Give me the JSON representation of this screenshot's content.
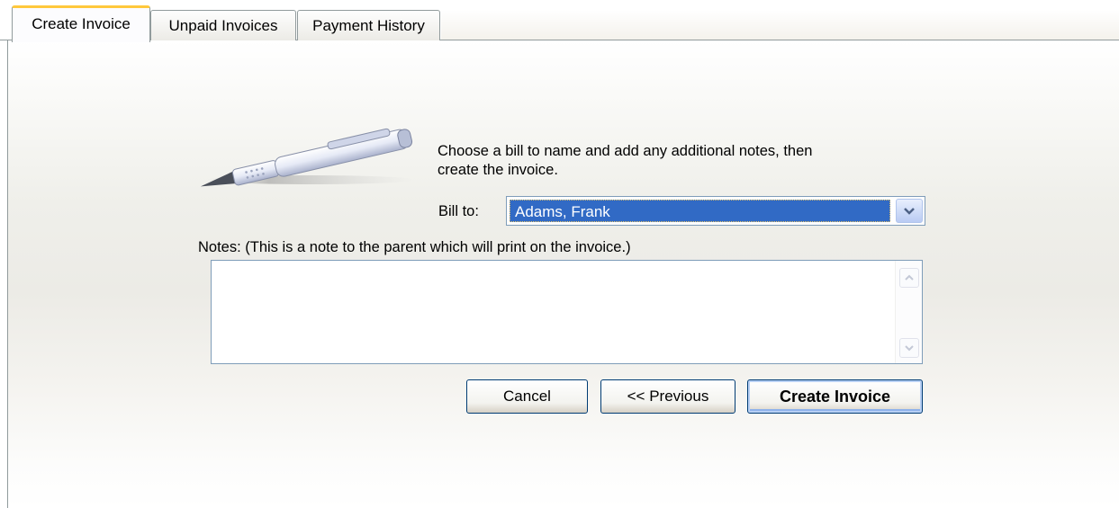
{
  "tabs": [
    {
      "label": "Create Invoice",
      "active": true
    },
    {
      "label": "Unpaid Invoices",
      "active": false
    },
    {
      "label": "Payment History",
      "active": false
    }
  ],
  "form": {
    "instruction": "Choose a bill to name and add any additional notes, then create the invoice.",
    "bill_to_label": "Bill to:",
    "bill_to_value": "Adams, Frank",
    "notes_label": "Notes: (This is a note to the parent which will print on the invoice.)",
    "notes_value": ""
  },
  "buttons": {
    "cancel": "Cancel",
    "previous": "<< Previous",
    "create": "Create Invoice"
  },
  "colors": {
    "selection": "#316ac5",
    "active_tab_accent": "#ffc83c",
    "button_border": "#003c74"
  },
  "icons": {
    "illustration": "pen-icon",
    "dropdown": "chevron-down-icon",
    "scroll_up": "scroll-up-icon",
    "scroll_down": "scroll-down-icon"
  }
}
